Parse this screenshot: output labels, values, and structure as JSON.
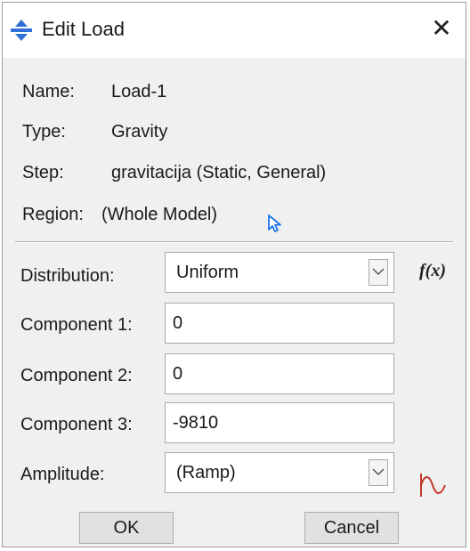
{
  "window": {
    "title": "Edit Load",
    "close_symbol": "✕",
    "icon": "load-icon"
  },
  "info": {
    "name_label": "Name:",
    "name_value": "Load-1",
    "type_label": "Type:",
    "type_value": "Gravity",
    "step_label": "Step:",
    "step_value": "gravitacija (Static, General)",
    "region_label": "Region:",
    "region_value": "(Whole Model)",
    "region_icon": "cursor-arrow-icon"
  },
  "form": {
    "distribution_label": "Distribution:",
    "distribution_value": "Uniform",
    "fx_label": "f(x)",
    "component1_label": "Component 1:",
    "component1_value": "0",
    "component2_label": "Component 2:",
    "component2_value": "0",
    "component3_label": "Component 3:",
    "component3_value": "-9810",
    "amplitude_label": "Amplitude:",
    "amplitude_value": "(Ramp)",
    "amplitude_icon": "amplitude-wave-icon"
  },
  "buttons": {
    "ok": "OK",
    "cancel": "Cancel"
  },
  "colors": {
    "cursor_blue": "#1a73e8",
    "amplitude_red": "#c0392b",
    "dialog_bg": "#f0f0f0"
  }
}
